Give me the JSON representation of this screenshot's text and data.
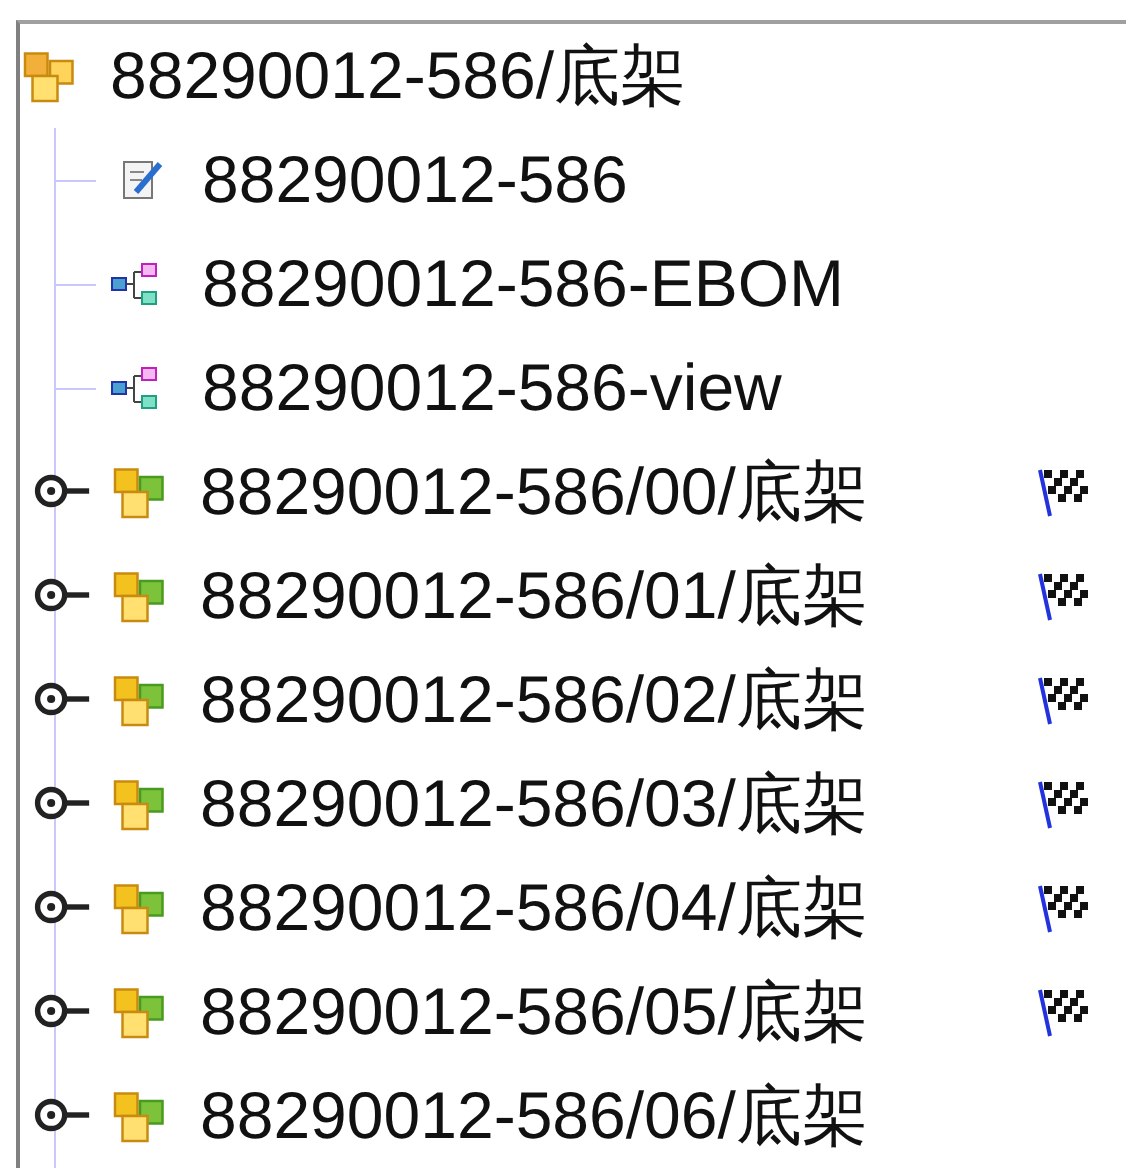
{
  "tree": {
    "label": "88290012-586/底架",
    "kind": "assembly",
    "children": [
      {
        "label": "88290012-586",
        "kind": "document"
      },
      {
        "label": "88290012-586-EBOM",
        "kind": "structure"
      },
      {
        "label": "88290012-586-view",
        "kind": "structure"
      },
      {
        "label": "88290012-586/00/底架",
        "kind": "assembly",
        "expanded": false,
        "flag": true
      },
      {
        "label": "88290012-586/01/底架",
        "kind": "assembly",
        "expanded": false,
        "flag": true
      },
      {
        "label": "88290012-586/02/底架",
        "kind": "assembly",
        "expanded": false,
        "flag": true
      },
      {
        "label": "88290012-586/03/底架",
        "kind": "assembly",
        "expanded": false,
        "flag": true
      },
      {
        "label": "88290012-586/04/底架",
        "kind": "assembly",
        "expanded": false,
        "flag": true
      },
      {
        "label": "88290012-586/05/底架",
        "kind": "assembly",
        "expanded": false,
        "flag": true
      },
      {
        "label": "88290012-586/06/底架",
        "kind": "assembly",
        "expanded": false,
        "flag": false
      }
    ]
  }
}
